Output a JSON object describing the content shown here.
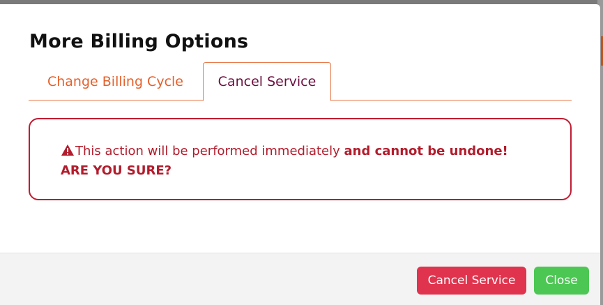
{
  "modal": {
    "title": "More Billing Options"
  },
  "tabs": [
    {
      "label": "Change Billing Cycle",
      "active": false
    },
    {
      "label": "Cancel Service",
      "active": true
    }
  ],
  "alert": {
    "icon": "warning-triangle-icon",
    "message": "This action will be performed immediately ",
    "emphasis": "and cannot be undone!",
    "question": "ARE YOU SURE?",
    "color": "#b21c2c"
  },
  "footer": {
    "cancel_label": "Cancel Service",
    "close_label": "Close"
  },
  "colors": {
    "accent": "#e4602a",
    "danger": "#e0344e",
    "success": "#4cc753"
  }
}
